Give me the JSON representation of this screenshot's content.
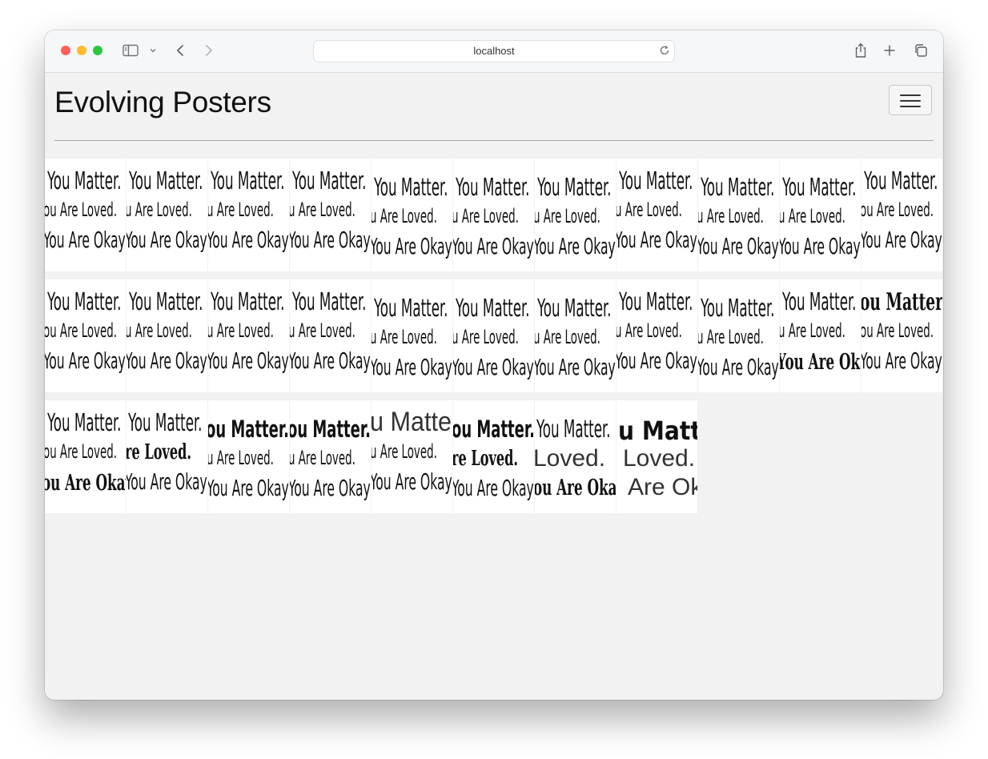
{
  "browser": {
    "url": "localhost"
  },
  "page": {
    "title": "Evolving Posters",
    "menu_label": "Toggle navigation"
  },
  "posters": [
    {
      "lines": [
        "You Matter.",
        "ou Are Loved.",
        "You Are Okay"
      ],
      "style": "condensed-light"
    },
    {
      "lines": [
        "You Matter.",
        "u Are Loved.",
        "You Are Okay"
      ],
      "style": "condensed-light"
    },
    {
      "lines": [
        "You Matter.",
        "u Are Loved.",
        "You Are Okay"
      ],
      "style": "condensed-light"
    },
    {
      "lines": [
        "You Matter.",
        "u Are Loved.",
        "You Are Okay"
      ],
      "style": "condensed-light"
    },
    {
      "lines": [
        "You Matter.",
        "u Are Loved.",
        "You Are Okay"
      ],
      "style": "condensed-light"
    },
    {
      "lines": [
        "You Matter.",
        "u Are Loved.",
        "You Are Okay"
      ],
      "style": "condensed-light"
    },
    {
      "lines": [
        "You Matter.",
        "u Are Loved.",
        "You Are Okay"
      ],
      "style": "condensed-light"
    },
    {
      "lines": [
        "You Matter.",
        "u Are Loved.",
        "You Are Okay"
      ],
      "style": "condensed-light"
    },
    {
      "lines": [
        "You Matter.",
        "u Are Loved.",
        "You Are Okay"
      ],
      "style": "condensed-light"
    },
    {
      "lines": [
        "You Matter.",
        "u Are Loved.",
        "You Are Okay"
      ],
      "style": "condensed-light"
    },
    {
      "lines": [
        "You Matter.",
        "ou Are Loved.",
        "You Are Okay"
      ],
      "style": "condensed-light"
    },
    {
      "lines": [
        "You Matter.",
        "ou Are Loved.",
        "You Are Okay"
      ],
      "style": "condensed-light"
    },
    {
      "lines": [
        "You Matter.",
        "u Are Loved.",
        "You Are Okay"
      ],
      "style": "condensed-light"
    },
    {
      "lines": [
        "You Matter.",
        "u Are Loved.",
        "You Are Okay"
      ],
      "style": "condensed-light"
    },
    {
      "lines": [
        "You Matter.",
        "u Are Loved.",
        "You Are Okay"
      ],
      "style": "condensed-light"
    },
    {
      "lines": [
        "You Matter.",
        "u Are Loved.",
        "You Are Okay"
      ],
      "style": "condensed-light"
    },
    {
      "lines": [
        "You Matter.",
        "u Are Loved.",
        "You Are Okay"
      ],
      "style": "condensed-light"
    },
    {
      "lines": [
        "You Matter.",
        "u Are Loved.",
        "You Are Okay"
      ],
      "style": "condensed-light"
    },
    {
      "lines": [
        "You Matter.",
        "u Are Loved.",
        "You Are Okay"
      ],
      "style": "condensed-light"
    },
    {
      "lines": [
        "You Matter.",
        "u Are Loved.",
        "You Are Okay"
      ],
      "style": "condensed-light"
    },
    {
      "lines": [
        "You Matter.",
        "u Are Loved.",
        "You Are Okay"
      ],
      "style": "mixed-bold-bottom"
    },
    {
      "lines": [
        "ou Matter.",
        "ou Are Loved.",
        "You Are Okay"
      ],
      "style": "mixed-bold-top"
    },
    {
      "lines": [
        "You Matter.",
        "ou Are Loved.",
        "ou Are Okay"
      ],
      "style": "mixed-bold-bottom"
    },
    {
      "lines": [
        "You Matter.",
        "re Loved.",
        "You Are Okay"
      ],
      "style": "mixed-bold-middle"
    },
    {
      "lines": [
        "ou Matter.",
        "u Are Loved.",
        "You Are Okay"
      ],
      "style": "black-top"
    },
    {
      "lines": [
        "ou Matter.",
        "u Are Loved.",
        "You Are Okay"
      ],
      "style": "black-top"
    },
    {
      "lines": [
        "u Matter.",
        "u Are Loved.",
        "You Are Okay"
      ],
      "style": "thin-top"
    },
    {
      "lines": [
        "ou Matter.",
        "re Loved.",
        "You Are Okay"
      ],
      "style": "black-top-bold-middle"
    },
    {
      "lines": [
        "You Matter.",
        "Loved.",
        "ou Are Okay"
      ],
      "style": "mixed-thin-middle"
    },
    {
      "lines": [
        "u Matter.",
        "Loved.",
        "Are Okay"
      ],
      "style": "geometric"
    }
  ]
}
